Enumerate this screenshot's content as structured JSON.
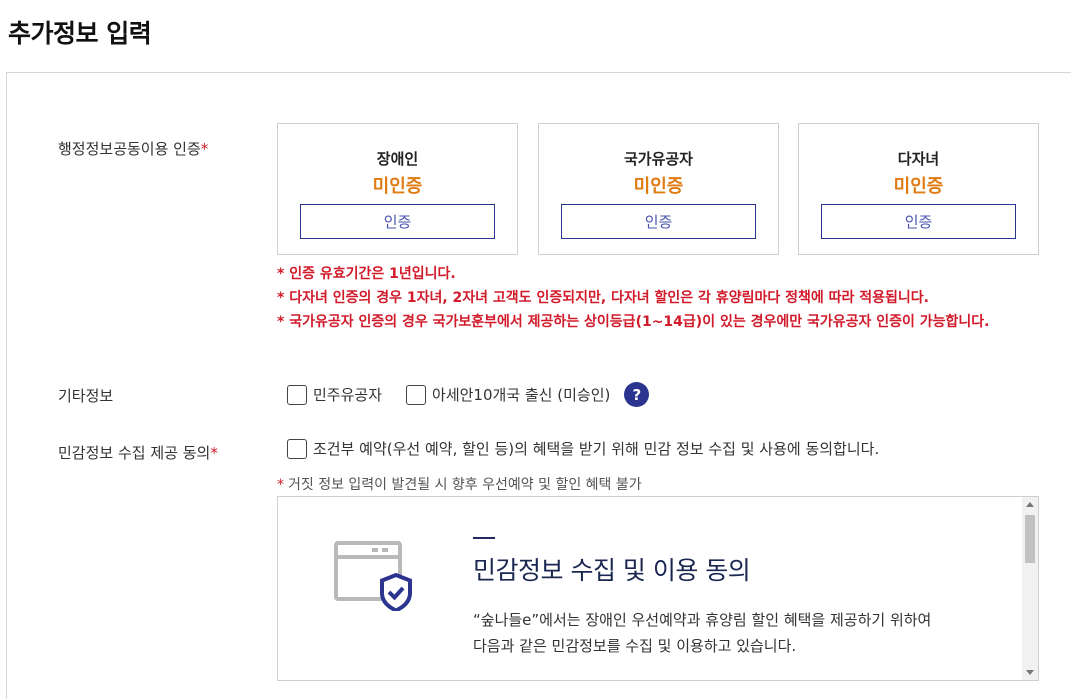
{
  "page": {
    "title": "추가정보 입력"
  },
  "admin_info": {
    "label": "행정정보공동이용 인증",
    "required_mark": "*",
    "cards": [
      {
        "name": "장애인",
        "status": "미인증",
        "button": "인증"
      },
      {
        "name": "국가유공자",
        "status": "미인증",
        "button": "인증"
      },
      {
        "name": "다자녀",
        "status": "미인증",
        "button": "인증"
      }
    ],
    "notes": [
      "* 인증 유효기간은 1년입니다.",
      "* 다자녀 인증의 경우 1자녀, 2자녀 고객도 인증되지만, 다자녀 할인은 각 휴양림마다 정책에 따라 적용됩니다.",
      "* 국가유공자 인증의 경우 국가보훈부에서 제공하는 상이등급(1~14급)이 있는 경우에만 국가유공자 인증이 가능합니다."
    ]
  },
  "other_info": {
    "label": "기타정보",
    "options": [
      "민주유공자",
      "아세안10개국 출신 (미승인)"
    ],
    "help": "?"
  },
  "sensitive": {
    "label": "민감정보 수집 제공 동의",
    "required_mark": "*",
    "checkbox_label": "조건부 예약(우선 예약, 할인 등)의 혜택을 받기 위해 민감 정보 수집 및 사용에 동의합니다.",
    "warning_mark": "*",
    "warning": "거짓 정보 입력이 발견될 시 향후 우선예약 및 할인 혜택 불가",
    "box": {
      "title": "민감정보 수집 및 이용 동의",
      "line1": "“숲나들e”에서는 장애인 우선예약과 휴양림 할인 혜택을 제공하기 위하여",
      "line2": "다음과 같은 민감정보를 수집 및 이용하고 있습니다."
    }
  },
  "colors": {
    "accent": "#2b3590",
    "status": "#e07b12",
    "required": "#d11a2a"
  }
}
